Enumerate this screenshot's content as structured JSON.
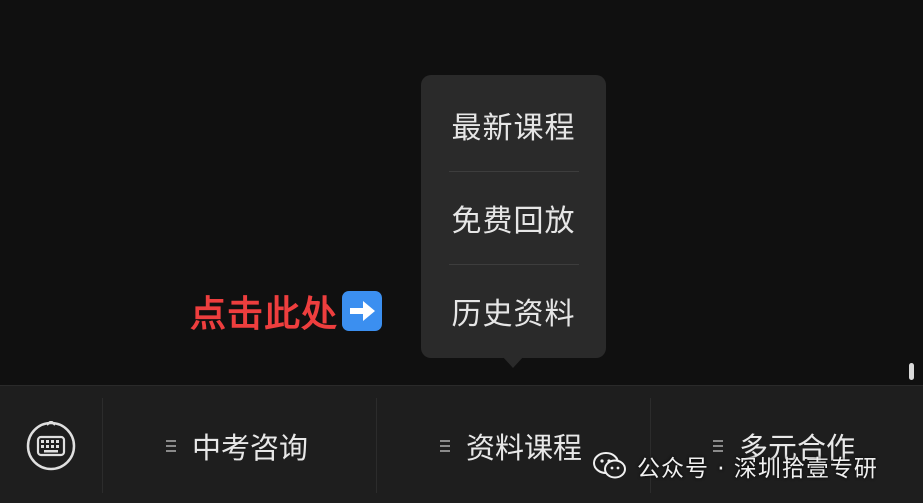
{
  "popup_menu": {
    "items": [
      {
        "label": "最新课程"
      },
      {
        "label": "免费回放"
      },
      {
        "label": "历史资料"
      }
    ]
  },
  "hint": {
    "text": "点击此处",
    "icon": "right-arrow-icon",
    "color": "#ee3e3e"
  },
  "menubar": {
    "keyboard_icon": "keyboard-icon",
    "items": [
      {
        "label": "中考咨询",
        "icon": "menu-list-icon"
      },
      {
        "label": "资料课程",
        "icon": "menu-list-icon"
      },
      {
        "label": "多元合作",
        "icon": "menu-list-icon"
      }
    ]
  },
  "watermark": {
    "icon": "wechat-icon",
    "text": "公众号 · 深圳拾壹专研"
  }
}
